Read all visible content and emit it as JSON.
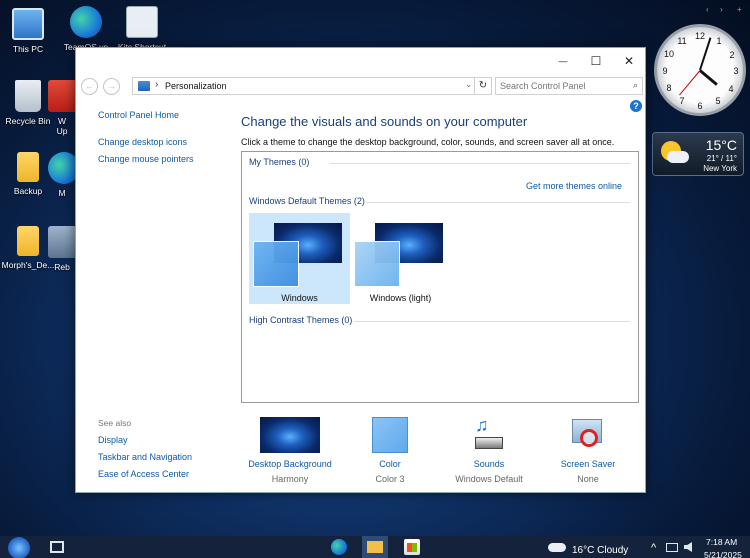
{
  "desktop": {
    "icons": [
      {
        "label": "This PC"
      },
      {
        "label": "TeamOS.vn"
      },
      {
        "label": "Kits Shortcut"
      },
      {
        "label": "Recycle Bin"
      },
      {
        "label": "W"
      },
      {
        "label": "Up"
      },
      {
        "label": "Backup"
      },
      {
        "label": "M"
      },
      {
        "label": "Morph's_De..."
      },
      {
        "label": "Reb"
      }
    ]
  },
  "gadgets": {
    "clock": {
      "numbers": [
        "12",
        "1",
        "2",
        "3",
        "4",
        "5",
        "6",
        "7",
        "8",
        "9",
        "10",
        "11"
      ]
    },
    "weather": {
      "temp": "15°C",
      "range": "21° / 11°",
      "city": "New York"
    },
    "controls": {
      "prev": "‹",
      "next": "›",
      "add": "+"
    }
  },
  "window": {
    "controls": {
      "minimize": "—",
      "maximize": "☐",
      "close": "✕"
    },
    "nav": {
      "back": "←",
      "forward": "→"
    },
    "address": {
      "separator": "›",
      "path": "Personalization",
      "dropdown": "⌄",
      "refresh": "↻"
    },
    "search": {
      "placeholder": "Search Control Panel",
      "icon": "⌕"
    },
    "help": "?",
    "sidebar": {
      "home": "Control Panel Home",
      "links": [
        "Change desktop icons",
        "Change mouse pointers"
      ],
      "see_also_header": "See also",
      "see_also": [
        "Display",
        "Taskbar and Navigation",
        "Ease of Access Center"
      ]
    },
    "main": {
      "title": "Change the visuals and sounds on your computer",
      "description": "Click a theme to change the desktop background, color, sounds, and screen saver all at once.",
      "my_themes": "My Themes (0)",
      "get_more": "Get more themes online",
      "default_themes": "Windows Default Themes (2)",
      "themes": [
        {
          "name": "Windows",
          "selected": true
        },
        {
          "name": "Windows (light)",
          "selected": false
        }
      ],
      "high_contrast": "High Contrast Themes (0)"
    },
    "bottom": [
      {
        "label": "Desktop Background",
        "value": "Harmony"
      },
      {
        "label": "Color",
        "value": "Color 3"
      },
      {
        "label": "Sounds",
        "value": "Windows Default"
      },
      {
        "label": "Screen Saver",
        "value": "None"
      }
    ]
  },
  "taskbar": {
    "weather": "16°C  Cloudy",
    "tray": "^",
    "time": "7:18 AM",
    "date": "5/21/2025"
  }
}
